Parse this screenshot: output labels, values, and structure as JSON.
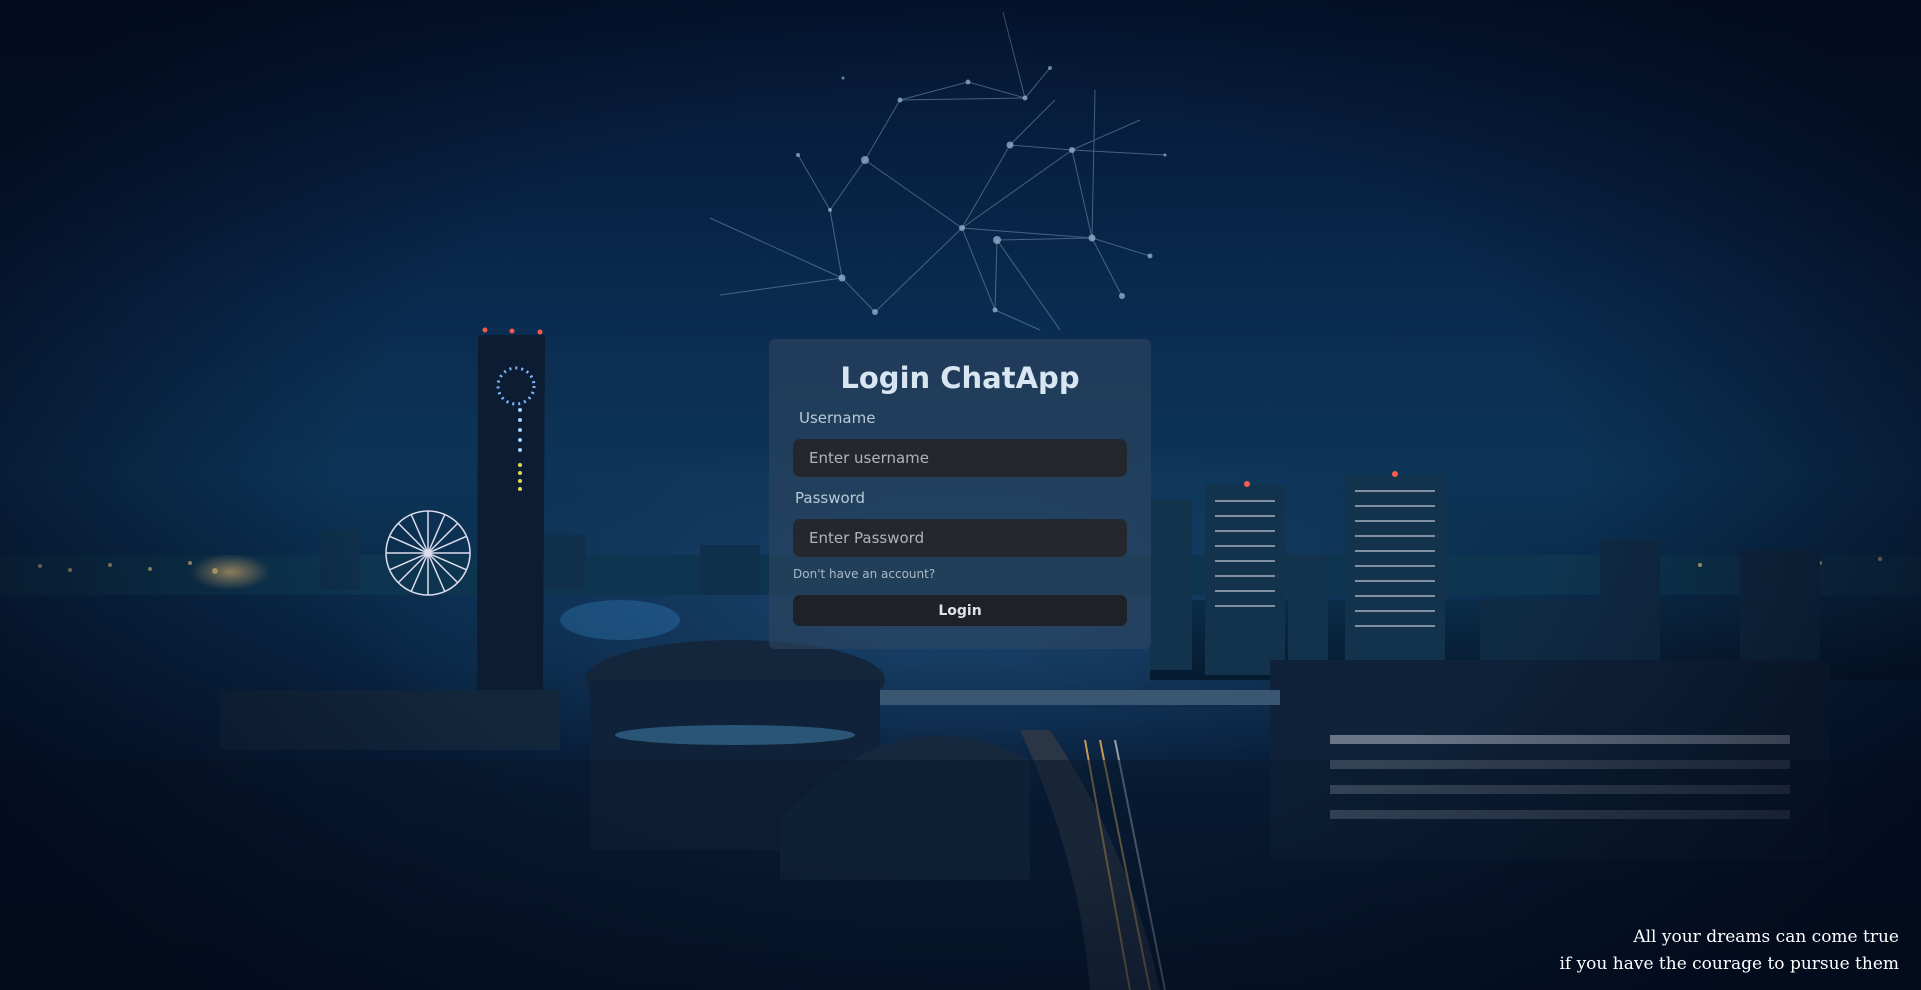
{
  "login": {
    "title": "Login ChatApp",
    "username_label": "Username",
    "username_placeholder": "Enter username",
    "password_label": "Password",
    "password_placeholder": "Enter Password",
    "signup_link": "Don't have an account?",
    "login_button": "Login"
  },
  "quote": {
    "line1": "All your dreams can come true",
    "line2": "if you have the courage to pursue them"
  },
  "colors": {
    "card_bg": "#2d465f",
    "input_bg": "#24272e",
    "button_bg": "#1e2127",
    "title": "#d8e6f2"
  }
}
